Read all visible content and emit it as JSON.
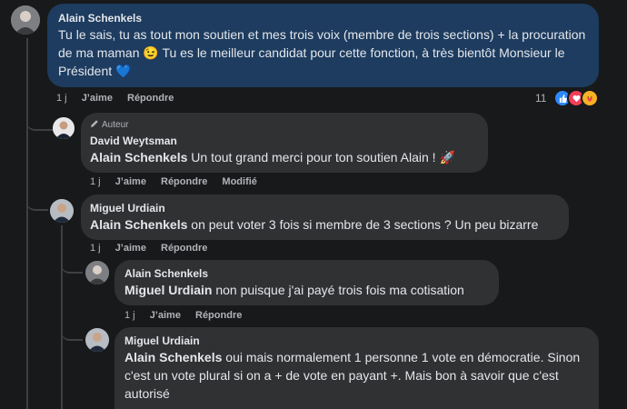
{
  "comments": [
    {
      "author": "Alain Schenkels",
      "text": "Tu le sais, tu as tout mon soutien et mes trois voix (membre de trois sections) + la procuration de ma maman 😉 Tu es le meilleur candidat pour cette fonction, à très bientôt Monsieur le Président 💙",
      "actions": {
        "time": "1 j",
        "like": "J’aime",
        "reply": "Répondre"
      },
      "reactions": {
        "count": "11"
      }
    },
    {
      "badge": "Auteur",
      "author": "David Weytsman",
      "mention": "Alain Schenkels",
      "text": " Un tout grand merci pour ton soutien Alain ! 🚀",
      "actions": {
        "time": "1 j",
        "like": "J’aime",
        "reply": "Répondre",
        "edited": "Modifié"
      }
    },
    {
      "author": "Miguel Urdiain",
      "mention": "Alain Schenkels",
      "text": " on peut voter 3 fois si membre de 3 sections ? Un peu bizarre",
      "actions": {
        "time": "1 j",
        "like": "J’aime",
        "reply": "Répondre"
      }
    },
    {
      "author": "Alain Schenkels",
      "mention": "Miguel Urdiain",
      "text": " non puisque j'ai payé trois fois ma cotisation",
      "actions": {
        "time": "1 j",
        "like": "J’aime",
        "reply": "Répondre"
      }
    },
    {
      "author": "Miguel Urdiain",
      "mention": "Alain Schenkels",
      "text": " oui mais normalement 1 personne 1 vote en démocratie. Sinon c'est un vote plural si on a + de vote en payant +. Mais bon à savoir que c'est autorisé"
    }
  ],
  "colors": {
    "highlight_bubble": "#1d3c5f",
    "bubble": "#303133",
    "like": "#2d88ff",
    "love": "#f33e58",
    "care": "#f7b125"
  },
  "icons": [
    "pencil-icon",
    "like-reaction-icon",
    "love-reaction-icon",
    "care-reaction-icon"
  ]
}
